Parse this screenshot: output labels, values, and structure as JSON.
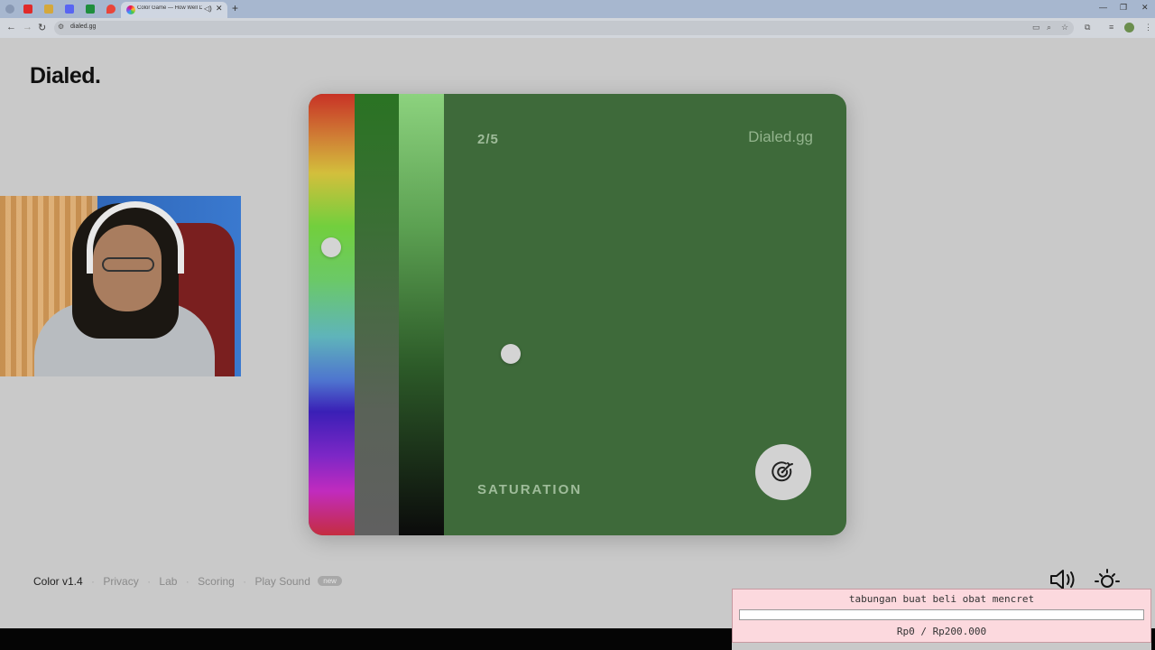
{
  "browser": {
    "tab_title": "Color Game — How Well D",
    "url": "dialed.gg",
    "new_tab_icon": "plus-icon",
    "window_controls": [
      "—",
      "❐",
      "✕"
    ]
  },
  "site": {
    "logo": "Dialed."
  },
  "game": {
    "progress": "2/5",
    "brand": "Dialed.gg",
    "stage_label": "SATURATION",
    "submit_icon": "target-icon",
    "current_color": "#3e6a3a",
    "hue_level": 0.34,
    "saturation_level": 0.48,
    "brightness_level": 0.59
  },
  "footer": {
    "version": "Color v1.4",
    "links": [
      "Privacy",
      "Lab",
      "Scoring",
      "Play Sound"
    ],
    "badge": "new",
    "sound_icon": "speaker-icon",
    "theme_icon": "sun-icon"
  },
  "donation": {
    "title": "tabungan buat beli obat mencret",
    "progress_fraction": 0,
    "amount": "Rp0 / Rp200.000"
  }
}
